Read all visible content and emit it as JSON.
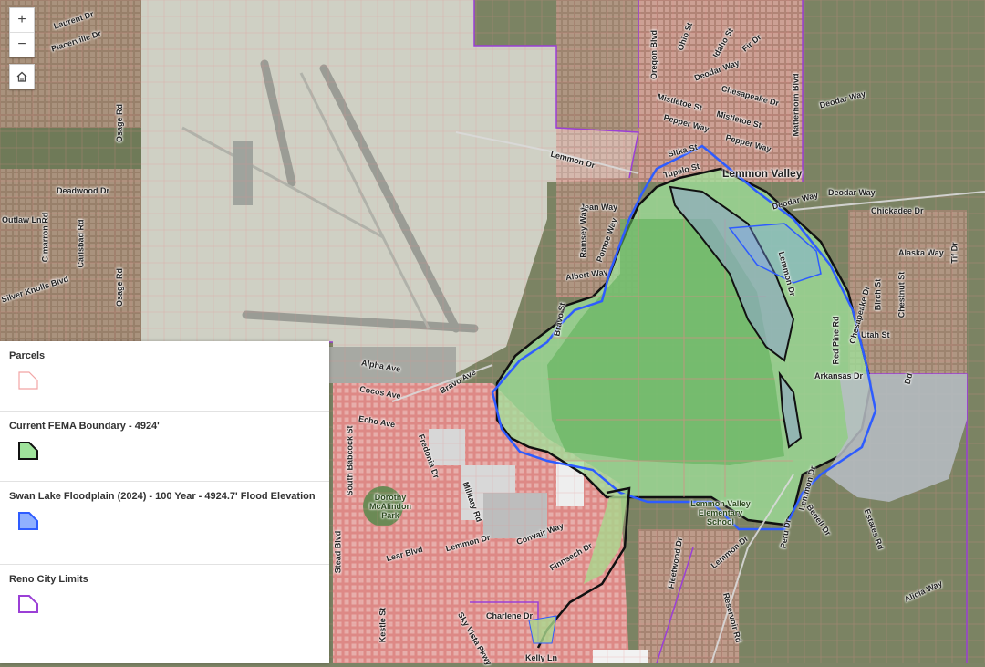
{
  "controls": {
    "zoom_in": "+",
    "zoom_out": "−"
  },
  "legend": {
    "items": [
      {
        "title": "Parcels"
      },
      {
        "title": "Current FEMA Boundary - 4924'"
      },
      {
        "title": "Swan Lake Floodplain (2024) - 100 Year - 4924.7' Flood Elevation"
      },
      {
        "title": "Reno City Limits"
      }
    ]
  },
  "map_labels": {
    "laurent": "Laurent Dr",
    "placerville": "Placerville Dr",
    "osage": "Osage Rd",
    "deadwood": "Deadwood Dr",
    "cimarron": "Cimarron Rd",
    "carlsbad": "Carlsbad Rd",
    "outlaw": "Outlaw Ln",
    "silverknolls": "Silver Knolls Blvd",
    "osage2": "Osage Rd",
    "oregon": "Oregon Blvd",
    "ohio": "Ohio St",
    "idaho": "Idaho St",
    "fir": "Fir Dr",
    "deodar1": "Deodar Way",
    "deodar2": "Deodar Way",
    "deodar3": "Deodar Way",
    "deodar4": "Deodar Way",
    "mistletoe1": "Mistletoe St",
    "mistletoe2": "Mistletoe St",
    "chesapeake1": "Chesapeake Dr",
    "pepper1": "Pepper Way",
    "pepper2": "Pepper Way",
    "matterhorn": "Matterhorn Blvd",
    "sitka": "Sitka St",
    "tupelo": "Tupelo St",
    "lemmon_valley": "Lemmon Valley",
    "lemmon_dr1": "Lemmon Dr",
    "jean": "Jean Way",
    "ramsey": "Ramsey Way",
    "pompe": "Pompe Way",
    "chickadee": "Chickadee Dr",
    "alaska": "Alaska Way",
    "tif": "Tif Dr",
    "albert": "Albert Way",
    "lemmon_dr2": "Lemmon Dr",
    "chesapeake2": "Chesapeake Dr",
    "redpine": "Red Pine Rd",
    "birch": "Birch St",
    "chestnut": "Chestnut St",
    "utah": "Utah St",
    "arkansas": "Arkansas Dr",
    "bravo1": "Bravo St",
    "alpha": "Alpha Ave",
    "bravo2": "Bravo Ave",
    "cocos": "Cocos Ave",
    "echo": "Echo Ave",
    "fredonia": "Fredonia Dr",
    "militaryrd": "Military Rd",
    "dorothy": "Dorothy McAlindon Park",
    "lemmon_valley_school": "Lemmon Valley Elementary School",
    "lemmon_dr3": "Lemmon Dr",
    "lemmon_dr4": "Lemmon Dr",
    "peru": "Peru Dr",
    "bedell": "Bedell Dr",
    "estates": "Estates Rd",
    "convair": "Convair Way",
    "finnsech": "Finnsech Dr",
    "lear": "Lear Blvd",
    "lemmon_dr5": "Lemmon Dr",
    "fleetwood": "Fleetwood Dr",
    "reservoir": "Reservoir Rd",
    "alicia": "Alicia Way",
    "charlene": "Charlene Dr",
    "kelly": "Kelly Ln",
    "stead": "Stead Blvd",
    "south_babcock": "South Babcock St",
    "kestle": "Kestle St",
    "skyvista": "Sky Vista Pkwy",
    "dd": "Dd"
  },
  "colors": {
    "parcel": "#ff8b8b",
    "fema": "#9fe39b",
    "floodplain": "#4f7cff",
    "city_limits": "#9b3fd6"
  }
}
